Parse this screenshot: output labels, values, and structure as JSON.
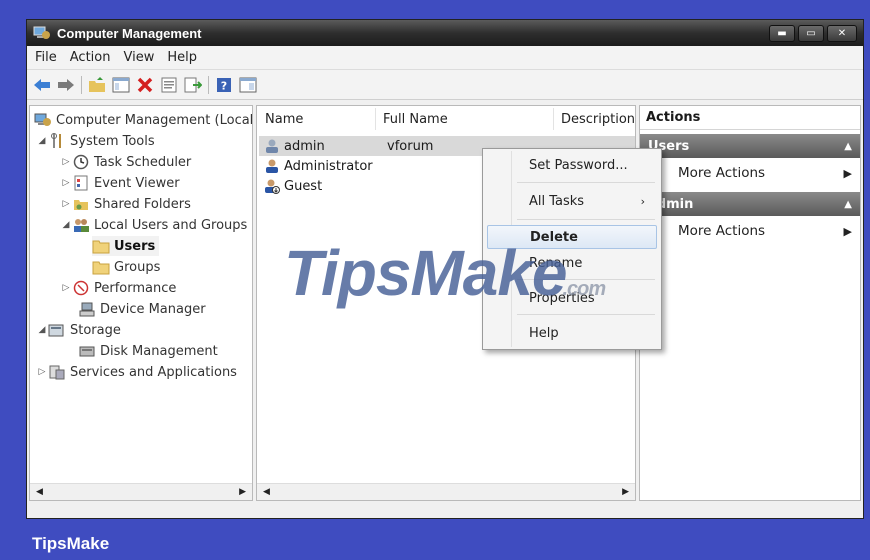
{
  "window": {
    "title": "Computer Management",
    "minimize": "▬",
    "maximize": "▭",
    "close": "✕"
  },
  "menu": [
    "File",
    "Action",
    "View",
    "Help"
  ],
  "tree": {
    "root": "Computer Management (Local",
    "system_tools": "System Tools",
    "task_scheduler": "Task Scheduler",
    "event_viewer": "Event Viewer",
    "shared_folders": "Shared Folders",
    "local_users_groups": "Local Users and Groups",
    "users": "Users",
    "groups": "Groups",
    "performance": "Performance",
    "device_manager": "Device Manager",
    "storage": "Storage",
    "disk_management": "Disk Management",
    "services_apps": "Services and Applications"
  },
  "list": {
    "columns": {
      "name": "Name",
      "full_name": "Full Name",
      "description": "Description"
    },
    "rows": [
      {
        "name": "admin",
        "full_name": "vforum"
      },
      {
        "name": "Administrator",
        "full_name": ""
      },
      {
        "name": "Guest",
        "full_name": ""
      }
    ]
  },
  "actions": {
    "title": "Actions",
    "section1": "Users",
    "section1_more": "More Actions",
    "section2": "admin",
    "section2_more": "More Actions"
  },
  "context_menu": {
    "set_password": "Set Password...",
    "all_tasks": "All Tasks",
    "delete": "Delete",
    "rename": "Rename",
    "properties": "Properties",
    "help": "Help"
  },
  "watermark": {
    "main": "TipsMake",
    "suffix": ".com"
  },
  "brand": "TipsMake",
  "colors": {
    "frame": "#3f4cc0",
    "section_header": "#6a6a6a",
    "selection": "#d9d9d9"
  }
}
